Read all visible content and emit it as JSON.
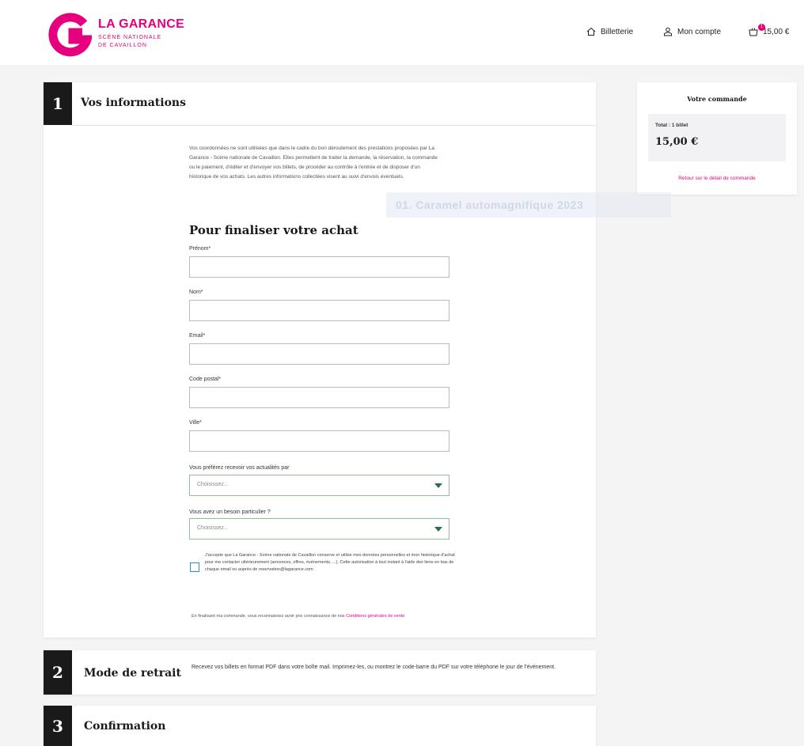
{
  "header": {
    "brand_title": "LA GARANCE",
    "brand_sub_1": "SCÈNE NATIONALE",
    "brand_sub_2": "DE CAVAILLON",
    "nav": {
      "billetterie": "Billetterie",
      "compte": "Mon compte",
      "cart_total": "15,00 €",
      "cart_count": "1"
    }
  },
  "step1": {
    "number": "1",
    "title": "Vos informations",
    "intro": "Vos coordonnées ne sont utilisées que dans le cadre du bon déroulement des prestations proposées par La Garance - Scène nationale de Cavaillon. Elles permettent de traiter la demande, la réservation, la commande ou le paiement, d'éditer et d'envoyer vos billets, de procéder au contrôle à l'entrée et de disposer d'un historique de vos achats. Les autres informations collectées visent au suivi d'envois éventuels.",
    "form_title": "Pour finaliser votre achat",
    "fields": {
      "prenom": "Prénom*",
      "nom": "Nom*",
      "email": "Email*",
      "code_postal": "Code postal*",
      "ville": "Ville*"
    },
    "select_news": {
      "label": "Vous préférez recevoir vos actualités par",
      "placeholder": "Choisissez..."
    },
    "select_besoin": {
      "label": "Vous avez un besoin particulier ?",
      "placeholder": "Choisissez..."
    },
    "consent": "J'accepte que La Garance - Scène nationale de Cavaillon conserve et utilise mes données personnelles et mon historique d'achat pour me contacter ultérieurement (annonces, offres, événements, ...). Cette autorisation à tout instant à l'aide des liens en bas de chaque email ou auprès de reservation@lagarance.com",
    "footnote_text": "En finalisant ma commande, vous reconnaissez avoir pris connaissance de nos",
    "footnote_link": "Conditions générales de vente"
  },
  "step2": {
    "number": "2",
    "title": "Mode de retrait",
    "desc": "Recevez vos billets en format PDF dans votre boîte mail. Imprimez-les, ou montrez le code-barre du PDF sur votre téléphone le jour de l'événement."
  },
  "step3": {
    "number": "3",
    "title": "Confirmation"
  },
  "order": {
    "title": "Votre commande",
    "total_label": "Total : 1 billet",
    "total_amount": "15,00 €",
    "link": "Retour sur le détail de commande"
  },
  "overlay_text": "01. Caramel automagnifique 2023",
  "colors": {
    "brand": "#e6007e",
    "step_bg": "#1a1a1a",
    "checkbox": "#2a8fbd",
    "select_border": "#8fbf9a"
  }
}
